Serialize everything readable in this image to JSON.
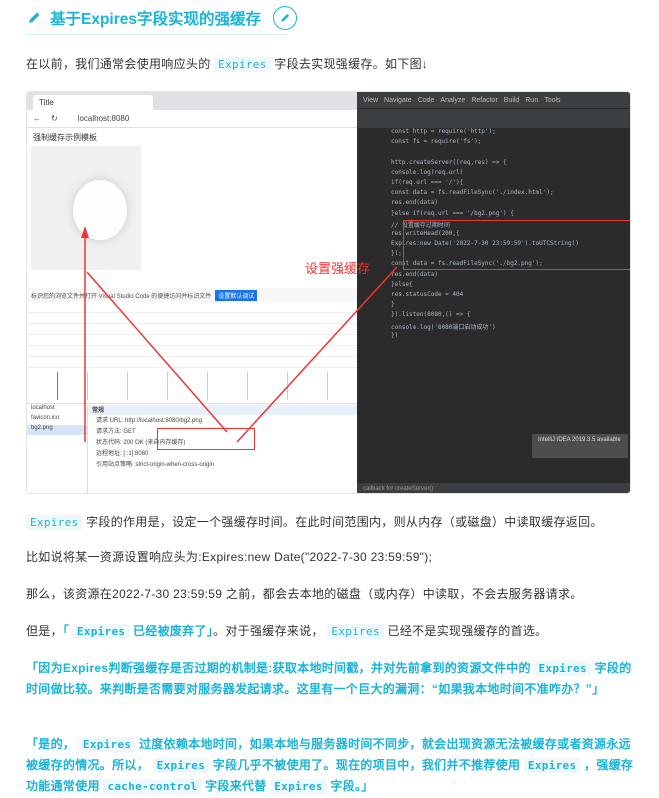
{
  "heading": {
    "title": "基于Expires字段实现的强缓存"
  },
  "intro": {
    "before": "在以前，我们通常会使用响应头的",
    "code": "Expires",
    "after": "字段去实现强缓存。如下图↓"
  },
  "screenshot": {
    "browser_tab": "Title",
    "url": "localhost:8080",
    "page_label": "强制缓存示例模板",
    "callout": "设置强缓存",
    "notice": "标识您的浏览文件并打开 Visual Studio Code 的便捷访问并标识文件",
    "notice_button": "设置默认调试",
    "files": [
      "localhost",
      "favicon.ico",
      "bg2.png"
    ],
    "details": [
      "请求 URL: http://localhost:8080/bg2.png",
      "请求方法: GET",
      "状态代码: 200 OK (来自内存缓存)",
      "远程地址: [::1]:8080",
      "引用站点策略: strict-origin-when-cross-origin"
    ],
    "details_header": "常规",
    "code_lines": [
      "const http = require('http');",
      "const fs = require('fs');",
      "",
      "http.createServer((req,res) => {",
      "  console.log(req.url)",
      "  if(req.url === '/'){",
      "    const data = fs.readFileSync('./index.html');",
      "    res.end(data)",
      "  }else if(req.url === '/bg2.png') {",
      "    // 设置缓存过期时间",
      "    res.writeHead(200,{",
      "      Expires:new Date('2022-7-30 23:59:59').toUTCString()",
      "    });",
      "    const data = fs.readFileSync('./bg2.png');",
      "    res.end(data)",
      "  }else{",
      "    res.statusCode = 404",
      "  }",
      "}).listen(8080,() => {",
      "  console.log('8080端口启动成功')",
      "})"
    ],
    "ide_status": "callback for createServer()",
    "ide_popup": "IntelliJ IDEA 2019.3.5 available"
  },
  "para1": {
    "code": "Expires",
    "text": "字段的作用是，设定一个强缓存时间。在此时间范围内，则从内存（或磁盘）中读取缓存返回。"
  },
  "para2": {
    "text": "比如说将某一资源设置响应头为:Expires:new Date(\"2022-7-30 23:59:59\");"
  },
  "para3": {
    "text": "那么，该资源在2022-7-30 23:59:59 之前，都会去本地的磁盘（或内存）中读取，不会去服务器请求。"
  },
  "para4": {
    "before": "但是，",
    "highlight_before": "「",
    "code1": "Expires",
    "highlight_text": "已经被废弃了」",
    "middle": "。对于强缓存来说，",
    "code2": "Expires",
    "after": "已经不是实现强缓存的首选。"
  },
  "quote1": {
    "a": "「因为Expires判断强缓存是否过期的机制是:获取本地时间戳，并对先前拿到的资源文件中的",
    "code": "Expires",
    "b": "字段的时间做比较。来判断是否需要对服务器发起请求。这里有一个巨大的漏洞：“如果我本地时间不准咋办？”」"
  },
  "quote2": {
    "a": "「是的，",
    "code1": "Expires",
    "b": "过度依赖本地时间，如果本地与服务器时间不同步，就会出现资源无法被缓存或者资源永远被缓存的情况。所以，",
    "code2": "Expires",
    "c": "字段几乎不被使用了。现在的项目中，我们并不推荐使用",
    "code3": "Expires",
    "d": "，强缓存功能通常使用",
    "code4": "cache-control",
    "e": "字段来代替",
    "code5": "Expires",
    "f": "字段。」"
  },
  "colors": {
    "accent": "#1bb4d8",
    "alert": "#e33333"
  }
}
